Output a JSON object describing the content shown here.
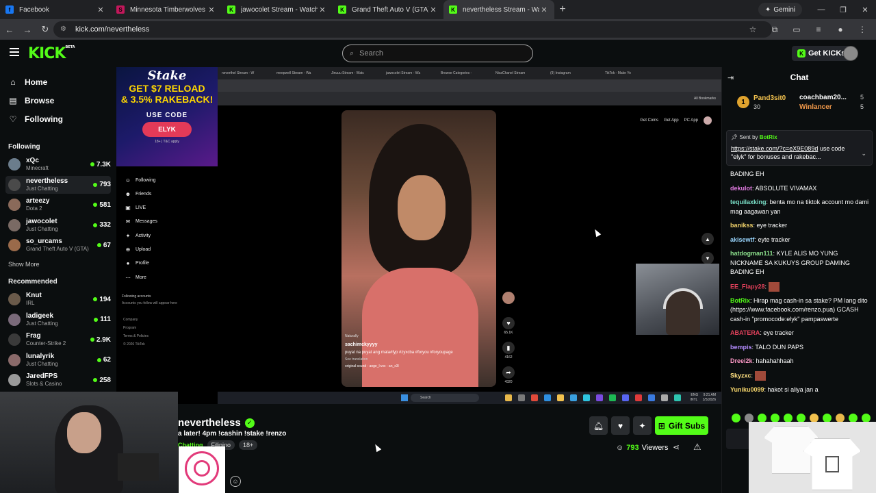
{
  "browser": {
    "tabs": [
      {
        "title": "Facebook",
        "fav_color": "#1877f2",
        "fav_letter": "f"
      },
      {
        "title": "Minnesota Timberwolves vs Wa",
        "fav_color": "#c2185b",
        "fav_letter": "S"
      },
      {
        "title": "jawocolet Stream - Watch Live o",
        "fav_color": "#53fc18",
        "fav_letter": "K"
      },
      {
        "title": "Grand Theft Auto V (GTA) Strea",
        "fav_color": "#53fc18",
        "fav_letter": "K"
      },
      {
        "title": "nevertheless Stream - Watc",
        "fav_color": "#53fc18",
        "fav_letter": "K",
        "active": true
      }
    ],
    "new_tab": "+",
    "gemini_label": "Gemini",
    "url": "kick.com/nevertheless"
  },
  "header": {
    "logo": "KICK",
    "logo_tag": "BETA",
    "search_placeholder": "Search",
    "get_kicks_label": "Get KICKs"
  },
  "sidebar": {
    "nav": [
      {
        "label": "Home",
        "icon": "home-icon",
        "glyph": "⌂"
      },
      {
        "label": "Browse",
        "icon": "browse-icon",
        "glyph": "▤"
      },
      {
        "label": "Following",
        "icon": "heart-icon",
        "glyph": "♡"
      }
    ],
    "following_title": "Following",
    "following": [
      {
        "name": "xQc",
        "category": "Minecraft",
        "viewers": "7.3K",
        "color": "#6b7d8c"
      },
      {
        "name": "nevertheless",
        "category": "Just Chatting",
        "viewers": "793",
        "color": "#4a4a4a",
        "active": true
      },
      {
        "name": "arteezy",
        "category": "Dota 2",
        "viewers": "581",
        "color": "#8a6a5a"
      },
      {
        "name": "jawocolet",
        "category": "Just Chatting",
        "viewers": "332",
        "color": "#7a6a64"
      },
      {
        "name": "so_urcams",
        "category": "Grand Theft Auto V (GTA)",
        "viewers": "67",
        "color": "#9a6a4a"
      }
    ],
    "show_more": "Show More",
    "recommended_title": "Recommended",
    "recommended": [
      {
        "name": "Knut",
        "category": "IRL",
        "viewers": "194",
        "color": "#6a5a4a"
      },
      {
        "name": "ladigeek",
        "category": "Just Chatting",
        "viewers": "111",
        "color": "#7a6a7a"
      },
      {
        "name": "Frag",
        "category": "Counter-Strike 2",
        "viewers": "2.9K",
        "color": "#3a3a3a"
      },
      {
        "name": "lunalyrik",
        "category": "Just Chatting",
        "viewers": "62",
        "color": "#8a6a6a"
      },
      {
        "name": "JaredFPS",
        "category": "Slots & Casino",
        "viewers": "258",
        "color": "#9a9a9a"
      }
    ]
  },
  "video": {
    "ad": {
      "brand": "Stake",
      "line1": "GET $7 RELOAD",
      "line2": "& 3.5% RAKEBACK!",
      "use_code": "USE CODE",
      "code": "ELYK",
      "terms": "18+ | T&C apply"
    },
    "inner_tabs": [
      "neverthel Stream - W",
      "meepwell Stream - Wa",
      "Jinuuu Stream - Watc",
      "jawocolet Stream - Wa",
      "Browse Categories -",
      "NicaChanel Stream",
      "(9) Instagram",
      "TikTok - Make Yo"
    ],
    "bookmarks_label": "All Bookmarks",
    "tiktok_nav": [
      {
        "label": "Following",
        "glyph": "☺"
      },
      {
        "label": "Friends",
        "glyph": "☻"
      },
      {
        "label": "LIVE",
        "glyph": "▣"
      },
      {
        "label": "Messages",
        "glyph": "✉"
      },
      {
        "label": "Activity",
        "glyph": "✦"
      },
      {
        "label": "Upload",
        "glyph": "⊕"
      },
      {
        "label": "Profile",
        "glyph": "●"
      },
      {
        "label": "More",
        "glyph": "⋯"
      }
    ],
    "following_accounts": "Following accounts",
    "following_accounts_sub": "Accounts you follow will appear here",
    "footer_links": [
      "Company",
      "Program",
      "Terms & Policies",
      "© 2026 TikTok"
    ],
    "top_links": [
      "Get Coins",
      "Get App",
      "PC App"
    ],
    "badge": "Naturally",
    "username": "sachimckyyyy",
    "caption": "puyat na puyat ang mata#fyp #zyxcba #foryou #foryoupage",
    "see_translation": "See translation",
    "sound": "original sound - ange_l:vxx - an_x3l",
    "actions": [
      {
        "count": "65.1K",
        "glyph": "♥",
        "icon": "like-icon"
      },
      {
        "count": "4162",
        "glyph": "▮",
        "icon": "bookmark-icon"
      },
      {
        "count": "4320",
        "glyph": "➦",
        "icon": "share-icon"
      }
    ],
    "taskbar_search": "Search",
    "taskbar_lang": "ENG",
    "taskbar_region": "INTL",
    "clock_time": "9:21 AM",
    "clock_date": "1/5/2026"
  },
  "stream": {
    "name": "nevertheless",
    "title": "a later! 4pm !cashin !stake !renzo",
    "category": "Chatting",
    "tags": [
      "Filipino",
      "18+"
    ],
    "viewers_count": "793",
    "viewers_label": "Viewers",
    "gift_subs_label": "Gift Subs"
  },
  "chat": {
    "title": "Chat",
    "leaderboard": {
      "first_rank": "1",
      "first_name": "Pand3sit0",
      "first_value": "30",
      "second_name": "coachbam20...",
      "second_value": "5",
      "third_name": "Winlancer",
      "third_value": "5"
    },
    "pinned": {
      "sent_by": "Sent by",
      "sender": "BotRix",
      "link": "https://stake.com/?c=eX9E089d",
      "text": " use code \"elyk\" for bonuses and rakebac..."
    },
    "messages": [
      {
        "user": "",
        "text": "BADING EH",
        "color": "#ffffff"
      },
      {
        "user": "dekulot",
        "text": "ABSOLUTE VIVAMAX",
        "color": "#e07ae0"
      },
      {
        "user": "tequilaxking",
        "text": "benta mo na tiktok account mo dami mag aagawan yan",
        "color": "#7ae0c8"
      },
      {
        "user": "banikss",
        "text": "eye tracker",
        "color": "#f2d36b"
      },
      {
        "user": "akisewtf",
        "text": "eyte tracker",
        "color": "#9ad7ff"
      },
      {
        "user": "hatdogman111",
        "text": "KYLE ALIS MO YUNG NICKNAME SA KUKUYS GROUP DAMING BADING EH",
        "color": "#8ce08c"
      },
      {
        "user": "EE_Flapy28",
        "text": "",
        "color": "#e0405a"
      },
      {
        "user": "BotRix",
        "text": "Hirap mag cash-in sa stake? PM lang dito (https://www.facebook.com/renzo.pua) GCASH cash-in \"promocode:elyk\" pampaswerte",
        "color": "#53fc18"
      },
      {
        "user": "ABATERA",
        "text": "eye tracker",
        "color": "#e0405a"
      },
      {
        "user": "bempis",
        "text": "TALO DUN PAPS",
        "color": "#b48cff"
      },
      {
        "user": "Dreei2k",
        "text": "hahahahhaah",
        "color": "#ff9ac8"
      },
      {
        "user": "Skyzxc",
        "text": "",
        "color": "#ffe080"
      },
      {
        "user": "Yuniku0099",
        "text": "hakot si aliya jan a",
        "color": "#f2d36b"
      }
    ]
  }
}
